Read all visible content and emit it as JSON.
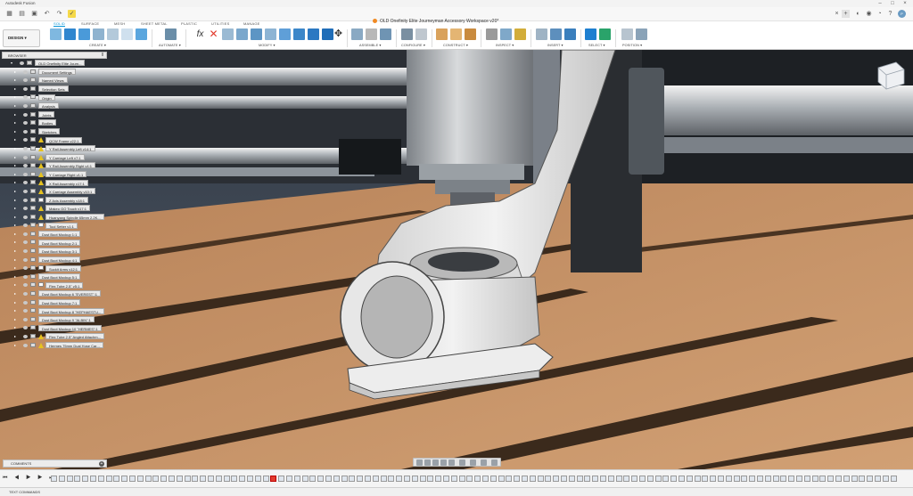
{
  "app": {
    "name": "Autodesk Fusion"
  },
  "document": {
    "title": "OLD Onefinity Elite Journeyman Accessory Workspace v20*"
  },
  "ribbon": {
    "tabs": [
      {
        "label": "SOLID",
        "active": true
      },
      {
        "label": "SURFACE"
      },
      {
        "label": "MESH"
      },
      {
        "label": "SHEET METAL"
      },
      {
        "label": "PLASTIC"
      },
      {
        "label": "UTILITIES"
      },
      {
        "label": "MANAGE"
      }
    ],
    "workspace": "DESIGN",
    "groups": [
      "CREATE ▾",
      "AUTOMATE ▾",
      "MODIFY ▾",
      "ASSEMBLE ▾",
      "CONFIGURE ▾",
      "CONSTRUCT ▾",
      "INSPECT ▾",
      "INSERT ▾",
      "SELECT ▾",
      "POSITION ▾"
    ]
  },
  "browser": {
    "title": "BROWSER",
    "items": [
      {
        "label": "OLD Onefinity Elite Journ...",
        "level": 0,
        "kind": "root"
      },
      {
        "label": "Document Settings",
        "level": 1,
        "kind": "folder"
      },
      {
        "label": "Named Views",
        "level": 1,
        "kind": "folder"
      },
      {
        "label": "Selection Sets",
        "level": 1,
        "kind": "folder"
      },
      {
        "label": "Origin",
        "level": 1,
        "kind": "folder"
      },
      {
        "label": "Analysis",
        "level": 1,
        "kind": "folder"
      },
      {
        "label": "Joints",
        "level": 1,
        "kind": "folder"
      },
      {
        "label": "Bodies",
        "level": 1,
        "kind": "folder"
      },
      {
        "label": "Sketches",
        "level": 1,
        "kind": "folder"
      },
      {
        "label": "QCW Frame v22:1",
        "level": 1,
        "kind": "comp-warn"
      },
      {
        "label": "Y Rail Assembly Left v14:1",
        "level": 1,
        "kind": "comp-warn"
      },
      {
        "label": "Y Carriage Left v7:1",
        "level": 1,
        "kind": "comp-warn"
      },
      {
        "label": "Y Rail Assembly Right v4:1",
        "level": 1,
        "kind": "comp-warn"
      },
      {
        "label": "Y Carriage Right v1:1",
        "level": 1,
        "kind": "comp-warn"
      },
      {
        "label": "X Rail Assembly v17:1",
        "level": 1,
        "kind": "comp-warn"
      },
      {
        "label": "X Carriage Assembly v10:1",
        "level": 1,
        "kind": "comp-warn"
      },
      {
        "label": "Z Axis Assembly v18:1",
        "level": 1,
        "kind": "comp-link"
      },
      {
        "label": "Makeo GO Touch v17:1",
        "level": 1,
        "kind": "comp-warn"
      },
      {
        "label": "Huanyang Spindle 65mm 2.2K...",
        "level": 1,
        "kind": "comp-warn"
      },
      {
        "label": "Tool Setter v1:1",
        "level": 1,
        "kind": "comp-link"
      },
      {
        "label": "Dust Boot Mockup 1:1",
        "level": 1,
        "kind": "comp"
      },
      {
        "label": "Dust Boot Mockup 2:1",
        "level": 1,
        "kind": "comp"
      },
      {
        "label": "Dust Boot Mockup 3:1",
        "level": 1,
        "kind": "comp"
      },
      {
        "label": "Dust Boot Mockup 4:1",
        "level": 1,
        "kind": "comp"
      },
      {
        "label": "Suckit Arms v12:1",
        "level": 1,
        "kind": "comp-link"
      },
      {
        "label": "Dust Boot Mockup 5:1",
        "level": 1,
        "kind": "comp"
      },
      {
        "label": "Flex Tube 2.5\" v5:1",
        "level": 1,
        "kind": "comp-link"
      },
      {
        "label": "Dust Boot Mockup 6 \"EVEREST\":1",
        "level": 1,
        "kind": "comp"
      },
      {
        "label": "Dust Boot Mockup 7:1",
        "level": 1,
        "kind": "comp"
      },
      {
        "label": "Dust Boot Mockup 8 \"HEPHAESTU...",
        "level": 1,
        "kind": "comp"
      },
      {
        "label": "Dust Boot Mockup 9 \"ALBIN\":1",
        "level": 1,
        "kind": "comp"
      },
      {
        "label": "Dust Boot Mockup 10 \"HERMES\":1",
        "level": 1,
        "kind": "comp"
      },
      {
        "label": "Flex Tube 2.5\" Angled Attachm...",
        "level": 1,
        "kind": "comp-warn"
      },
      {
        "label": "Hermes 75mm Dual Hose Car...",
        "level": 1,
        "kind": "comp-warn"
      }
    ]
  },
  "comments": {
    "title": "COMMENTS"
  },
  "textcommands": {
    "title": "TEXT COMMANDS"
  },
  "timeline": {
    "controls": "⏮ ◀ ▶ ▶ ⏭"
  },
  "colors": {
    "accent": "#0696d7",
    "wood": "#c9956a",
    "boot": "#e9e9e9",
    "warning": "#e6c21f"
  }
}
